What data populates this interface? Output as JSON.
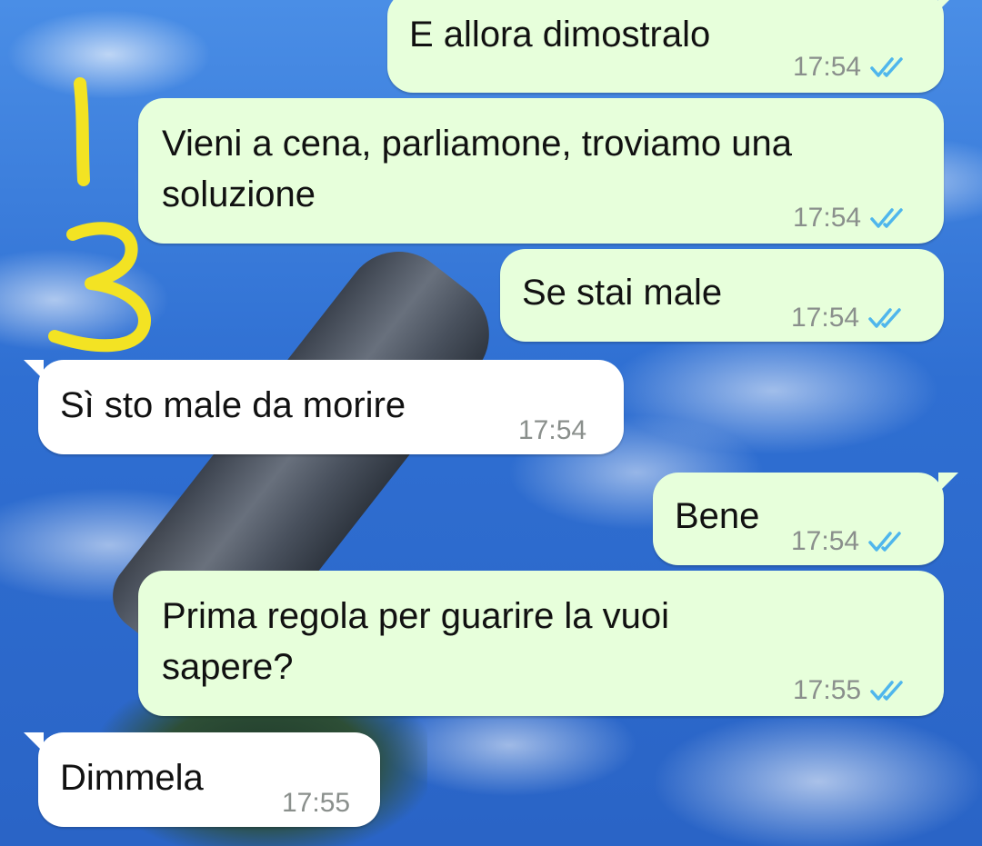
{
  "messages": [
    {
      "direction": "outgoing",
      "text": "E allora dimostralo",
      "time": "17:54",
      "status": "read"
    },
    {
      "direction": "outgoing",
      "text": "Vieni a cena, parliamone, troviamo una soluzione",
      "line1": "Vieni a cena, parliamone, troviamo una",
      "line2": "soluzione",
      "time": "17:54",
      "status": "read"
    },
    {
      "direction": "outgoing",
      "text": "Se stai male",
      "time": "17:54",
      "status": "read"
    },
    {
      "direction": "incoming",
      "text": "Sì sto male da morire",
      "time": "17:54"
    },
    {
      "direction": "outgoing",
      "text": "Bene",
      "time": "17:54",
      "status": "read"
    },
    {
      "direction": "outgoing",
      "text": "Prima regola per guarire la vuoi sapere?",
      "line1": "Prima regola per guarire la vuoi",
      "line2": "sapere?",
      "time": "17:55",
      "status": "read"
    },
    {
      "direction": "incoming",
      "text": "Dimmela",
      "time": "17:55"
    }
  ],
  "annotation": {
    "label": "1/3",
    "color": "#f3e323"
  },
  "colors": {
    "outgoing_bubble": "#e7ffdb",
    "incoming_bubble": "#ffffff",
    "read_ticks": "#4fb6ec",
    "timestamp": "#8a8f8c"
  },
  "icons": {
    "read_receipt": "double-check-icon"
  }
}
